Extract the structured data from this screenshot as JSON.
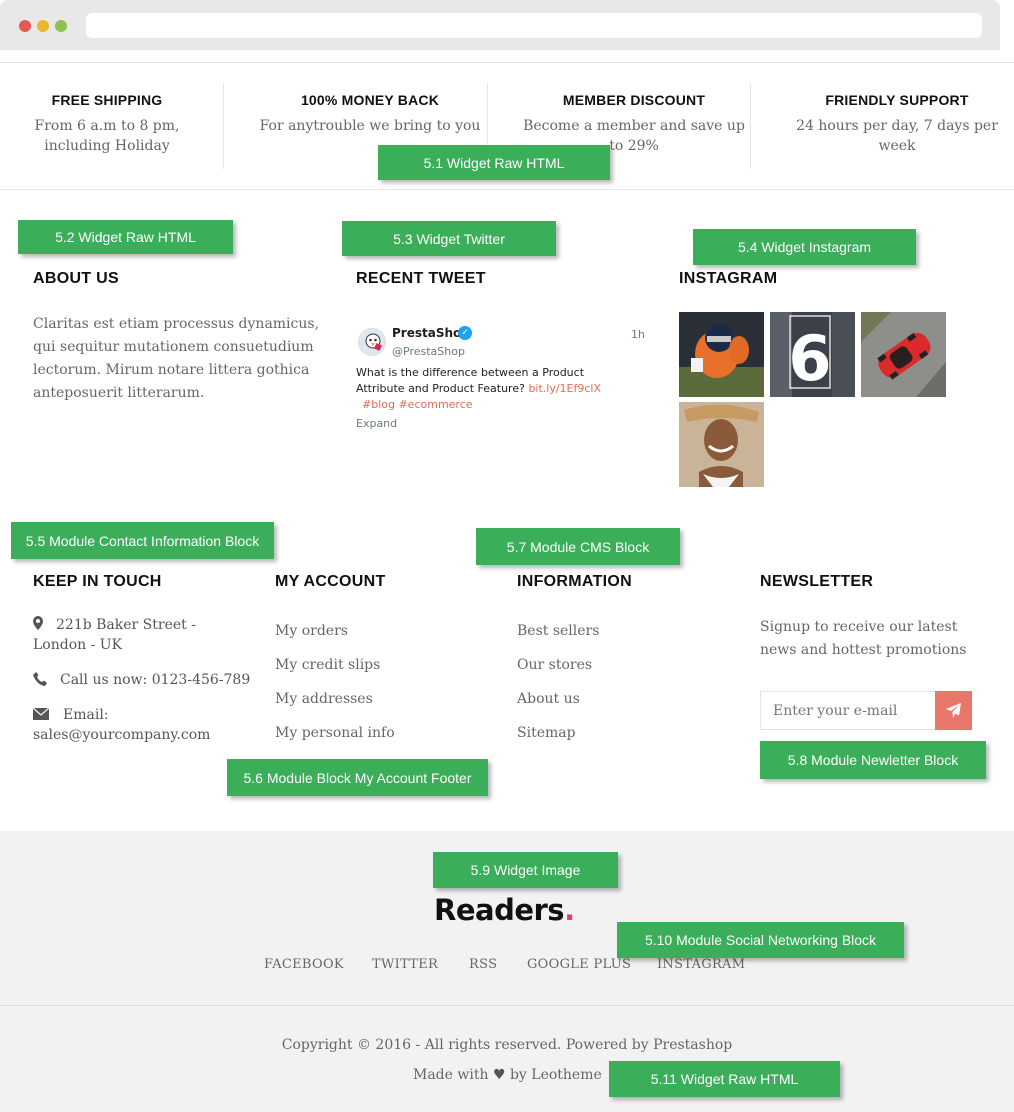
{
  "services": [
    {
      "title": "FREE SHIPPING",
      "desc": "From 6 a.m to 8 pm, including Holiday"
    },
    {
      "title": "100% MONEY BACK",
      "desc": "For anytrouble we bring to you"
    },
    {
      "title": "MEMBER DISCOUNT",
      "desc": "Become a member and save up to 29%"
    },
    {
      "title": "FRIENDLY SUPPORT",
      "desc": "24 hours per day, 7 days per week"
    }
  ],
  "about": {
    "title": "ABOUT US",
    "text": "Claritas est etiam processus dynamicus, qui sequitur mutationem consuetudium lectorum. Mirum notare littera gothica anteposuerit litterarum."
  },
  "twitter": {
    "title": "RECENT TWEET",
    "name": "PrestaShop",
    "handle": "@PrestaShop",
    "time": "1h",
    "text": "What is the difference between a Product Attribute and Product Feature?",
    "link": "bit.ly/1Ef9clX",
    "hashtags": "#blog #ecommerce",
    "expand": "Expand"
  },
  "instagram": {
    "title": "INSTAGRAM"
  },
  "contact": {
    "title": "KEEP IN TOUCH",
    "address": "221b Baker Street - London - UK",
    "phone": "Call us now: 0123-456-789",
    "email": "Email: sales@yourcompany.com"
  },
  "account": {
    "title": "MY ACCOUNT",
    "links": [
      "My orders",
      "My credit slips",
      "My addresses",
      "My personal info"
    ]
  },
  "information": {
    "title": "INFORMATION",
    "links": [
      "Best sellers",
      "Our stores",
      "About us",
      "Sitemap"
    ]
  },
  "newsletter": {
    "title": "NEWSLETTER",
    "text": "Signup to receive our latest news and hottest promotions",
    "placeholder": "Enter your e-mail"
  },
  "logo": {
    "text": "Readers",
    "dot": "."
  },
  "social": [
    "FACEBOOK",
    "TWITTER",
    "RSS",
    "GOOGLE PLUS",
    "INSTAGRAM"
  ],
  "copyright": "Copyright © 2016 - All rights reserved. Powered by Prestashop",
  "made_with": {
    "before": "Made with",
    "after": "by Leotheme"
  },
  "annotations": {
    "a51": "5.1 Widget Raw HTML",
    "a52": "5.2 Widget Raw HTML",
    "a53": "5.3 Widget Twitter",
    "a54": "5.4 Widget Instagram",
    "a55": "5.5 Module Contact Information Block",
    "a56": "5.6 Module Block My Account Footer",
    "a57": "5.7 Module CMS Block",
    "a58": "5.8 Module Newletter Block",
    "a59": "5.9 Widget Image",
    "a510": "5.10 Module Social Networking Block",
    "a511": "5.11 Widget Raw HTML"
  },
  "colors": {
    "accent": "#e8776a",
    "annotation_green": "#3bae5a",
    "logo_dot": "#e83e6c",
    "twitter_blue": "#1da1f2"
  }
}
